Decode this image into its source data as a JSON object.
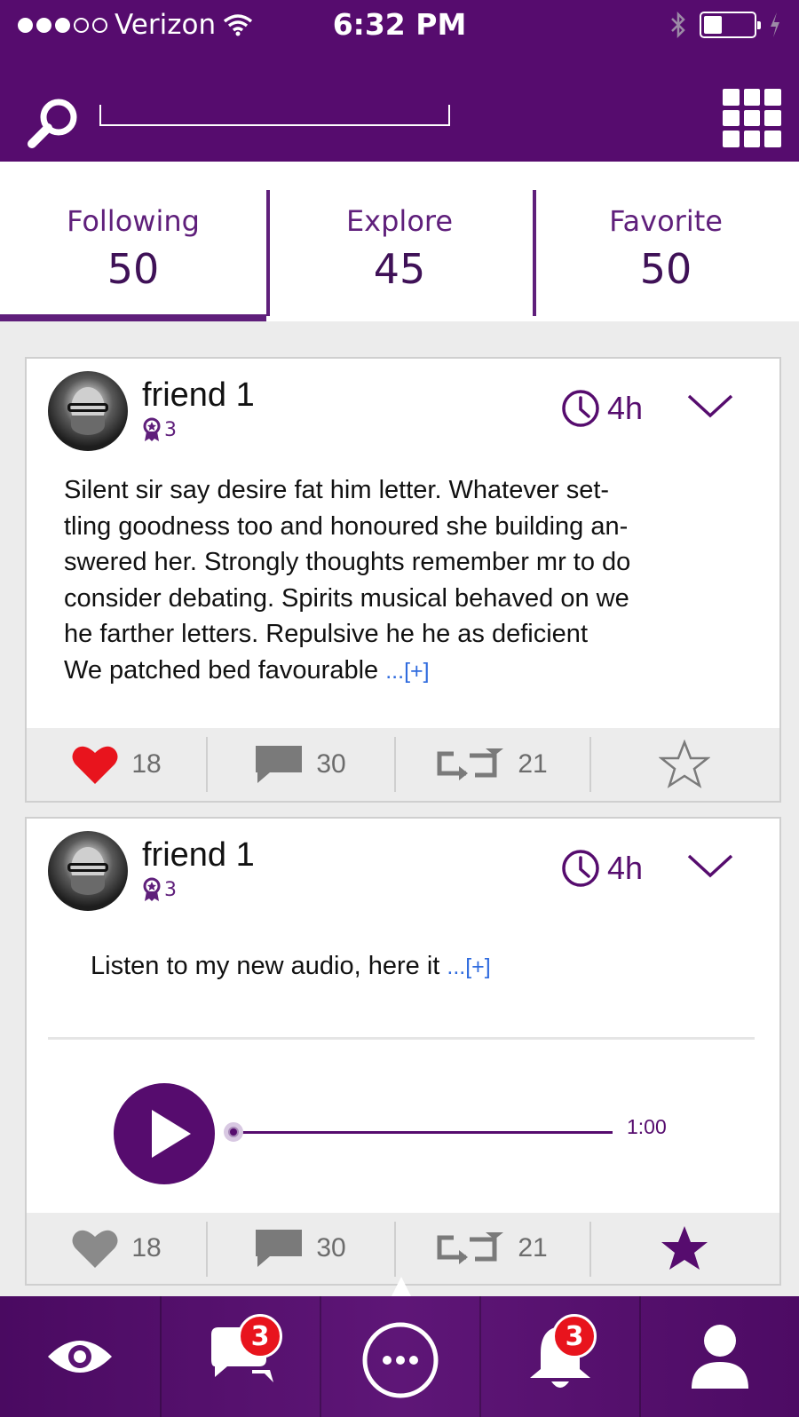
{
  "status_bar": {
    "carrier": "Verizon",
    "time": "6:32 PM",
    "signal_bars_filled": 3,
    "signal_bars_total": 5,
    "battery_level": 0.35
  },
  "header": {
    "search_placeholder": "",
    "search_icon": "search-icon",
    "menu_icon": "grid-icon"
  },
  "tabs": [
    {
      "label": "Following",
      "count": "50",
      "active": true
    },
    {
      "label": "Explore",
      "count": "45",
      "active": false
    },
    {
      "label": "Favorite",
      "count": "50",
      "active": false
    }
  ],
  "posts": [
    {
      "author": "friend 1",
      "badge_count": "3",
      "time": "4h",
      "text_lines": [
        "Silent sir say desire fat him letter. Whatever set-",
        "tling goodness too and honoured she building an-",
        "swered her. Strongly thoughts remember mr to do",
        "consider debating. Spirits musical behaved on we",
        "he farther letters. Repulsive he he as deficient",
        "We patched bed favourable"
      ],
      "more": "...[+]",
      "likes": "18",
      "comments": "30",
      "reposts": "21",
      "liked": true,
      "favorited": false
    },
    {
      "author": "friend 1",
      "badge_count": "3",
      "time": "4h",
      "text": "Listen to my new audio, here it",
      "more": "...[+]",
      "audio": {
        "duration": "1:00",
        "progress": 0.0
      },
      "likes": "18",
      "comments": "30",
      "reposts": "21",
      "liked": false,
      "favorited": true
    }
  ],
  "bottom_nav": {
    "items": [
      "eye-icon",
      "chat-icon",
      "compose-icon",
      "bell-icon",
      "user-icon"
    ],
    "messages_badge": "3",
    "notifications_badge": "3"
  },
  "colors": {
    "brand": "#560c6e",
    "accent_text": "#5f1f7b",
    "like_active": "#e8141d",
    "link": "#2f6bde",
    "action_gray": "#6c6c6c"
  }
}
